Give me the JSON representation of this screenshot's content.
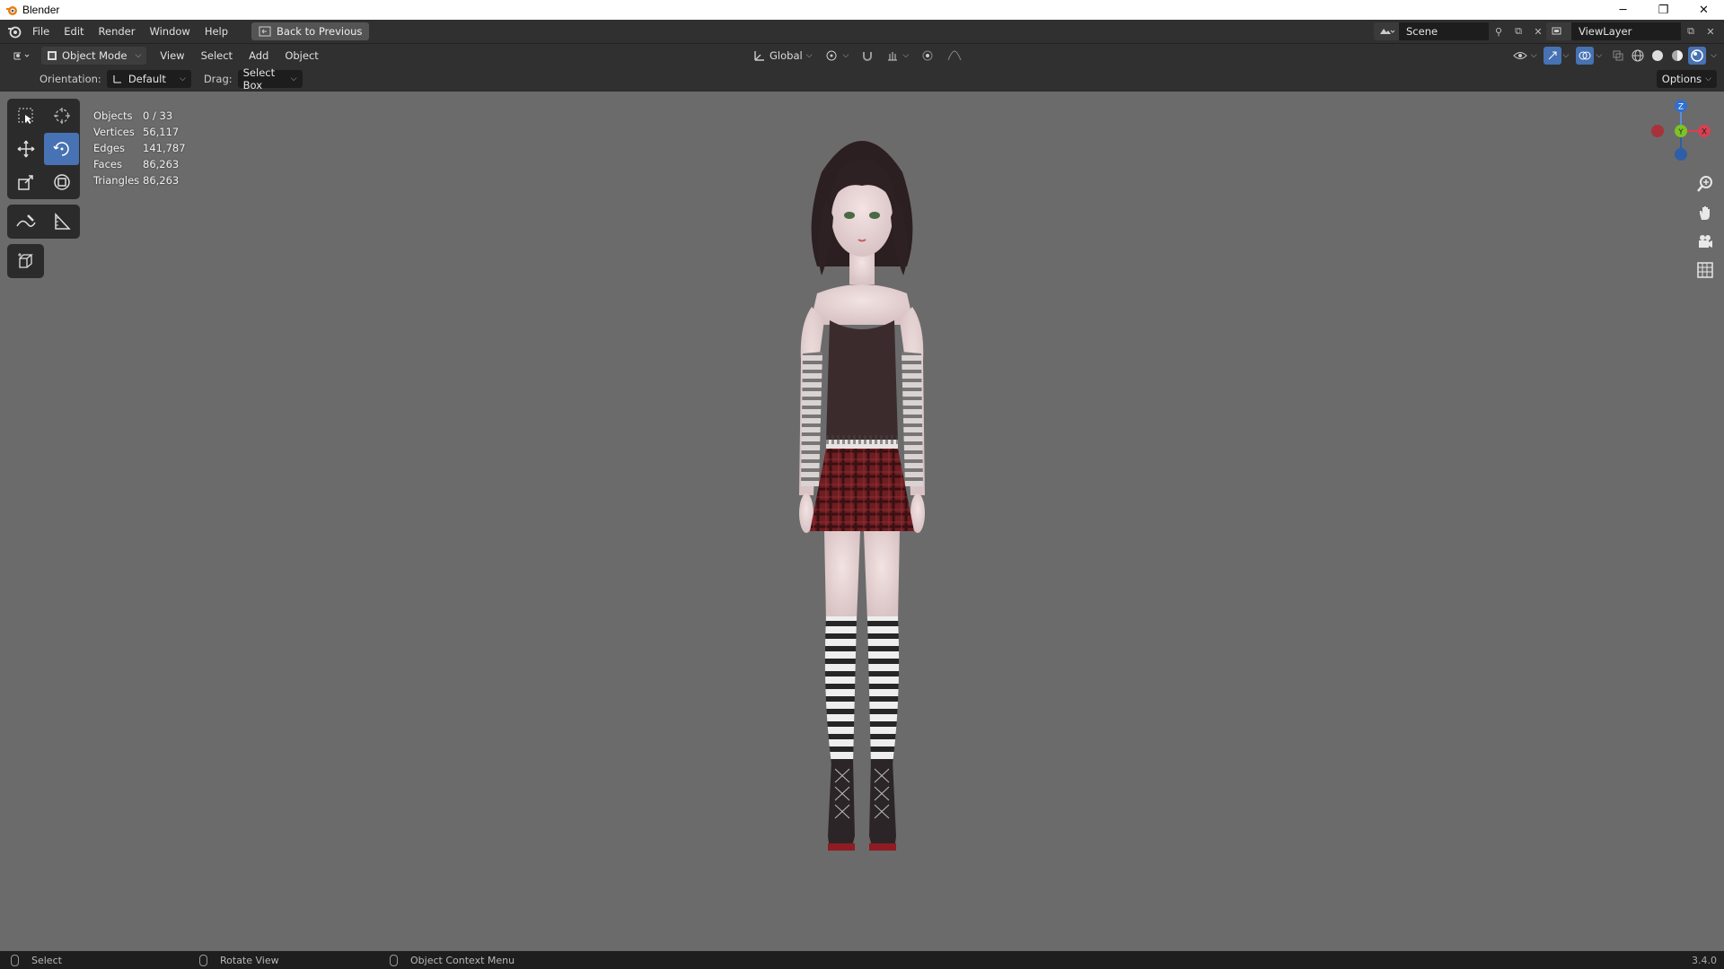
{
  "window": {
    "title": "Blender",
    "minimize": "─",
    "maximize": "❐",
    "close": "✕"
  },
  "topbar": {
    "menus": [
      "File",
      "Edit",
      "Render",
      "Window",
      "Help"
    ],
    "back_button": "Back to Previous",
    "scene": "Scene",
    "view_layer": "ViewLayer"
  },
  "header": {
    "mode": "Object Mode",
    "menus": [
      "View",
      "Select",
      "Add",
      "Object"
    ],
    "orientation_global": "Global"
  },
  "tool_settings": {
    "orientation_label": "Orientation:",
    "orientation_value": "Default",
    "drag_label": "Drag:",
    "drag_value": "Select Box",
    "options": "Options"
  },
  "stats": [
    {
      "key": "Objects",
      "value": "0 / 33"
    },
    {
      "key": "Vertices",
      "value": "56,117"
    },
    {
      "key": "Edges",
      "value": "141,787"
    },
    {
      "key": "Faces",
      "value": "86,263"
    },
    {
      "key": "Triangles",
      "value": "86,263"
    }
  ],
  "gizmo": {
    "z": "Z",
    "y": "Y",
    "x": "X"
  },
  "statusbar": {
    "select": "Select",
    "rotate": "Rotate View",
    "context": "Object Context Menu",
    "version": "3.4.0"
  },
  "colors": {
    "accent": "#4772b3",
    "viewport_bg": "#6b6b6b",
    "header_bg": "#303030"
  }
}
